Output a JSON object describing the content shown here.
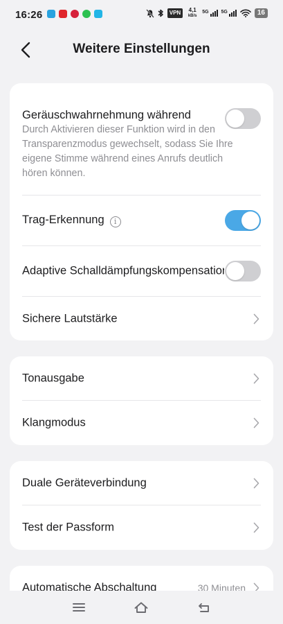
{
  "status_bar": {
    "time": "16:26",
    "notification_apps": [
      {
        "icon": "telegram-icon",
        "color": "#2aa3df"
      },
      {
        "icon": "youtube-icon",
        "color": "#e0262c"
      },
      {
        "icon": "pinterest-icon",
        "color": "#d6213a"
      },
      {
        "icon": "whatsapp-icon",
        "color": "#2cc150"
      },
      {
        "icon": "tiktok-icon",
        "color": "#22b5e6"
      }
    ],
    "vpn": "VPN",
    "speed_value": "4,1",
    "speed_unit": "kB/s",
    "net1": "5G",
    "net2": "5G",
    "battery": "16"
  },
  "header": {
    "title": "Weitere Einstellungen"
  },
  "card1": {
    "noise_awareness": {
      "label": "Geräuschwahrnehmung während",
      "description": "Durch Aktivieren dieser Funktion wird in den Transparenzmodus gewechselt, sodass Sie Ihre eigene Stimme während eines Anrufs deutlich hören können.",
      "enabled": false
    },
    "wear_detection": {
      "label": "Trag-Erkennung",
      "info": "i",
      "enabled": true
    },
    "adaptive_compensation": {
      "label": "Adaptive Schalldämpfungskompensation",
      "enabled": false
    },
    "safe_volume": {
      "label": "Sichere Lautstärke"
    }
  },
  "card2": {
    "items": [
      {
        "label": "Tonausgabe"
      },
      {
        "label": "Klangmodus"
      }
    ]
  },
  "card3": {
    "items": [
      {
        "label": "Duale Geräteverbindung"
      },
      {
        "label": "Test der Passform"
      }
    ]
  },
  "card4": {
    "auto_off": {
      "label": "Automatische Abschaltung",
      "value": "30 Minuten"
    }
  },
  "colors": {
    "accent": "#4aa8e6",
    "toggle_off": "#cfcfd2",
    "background": "#f2f2f4"
  }
}
